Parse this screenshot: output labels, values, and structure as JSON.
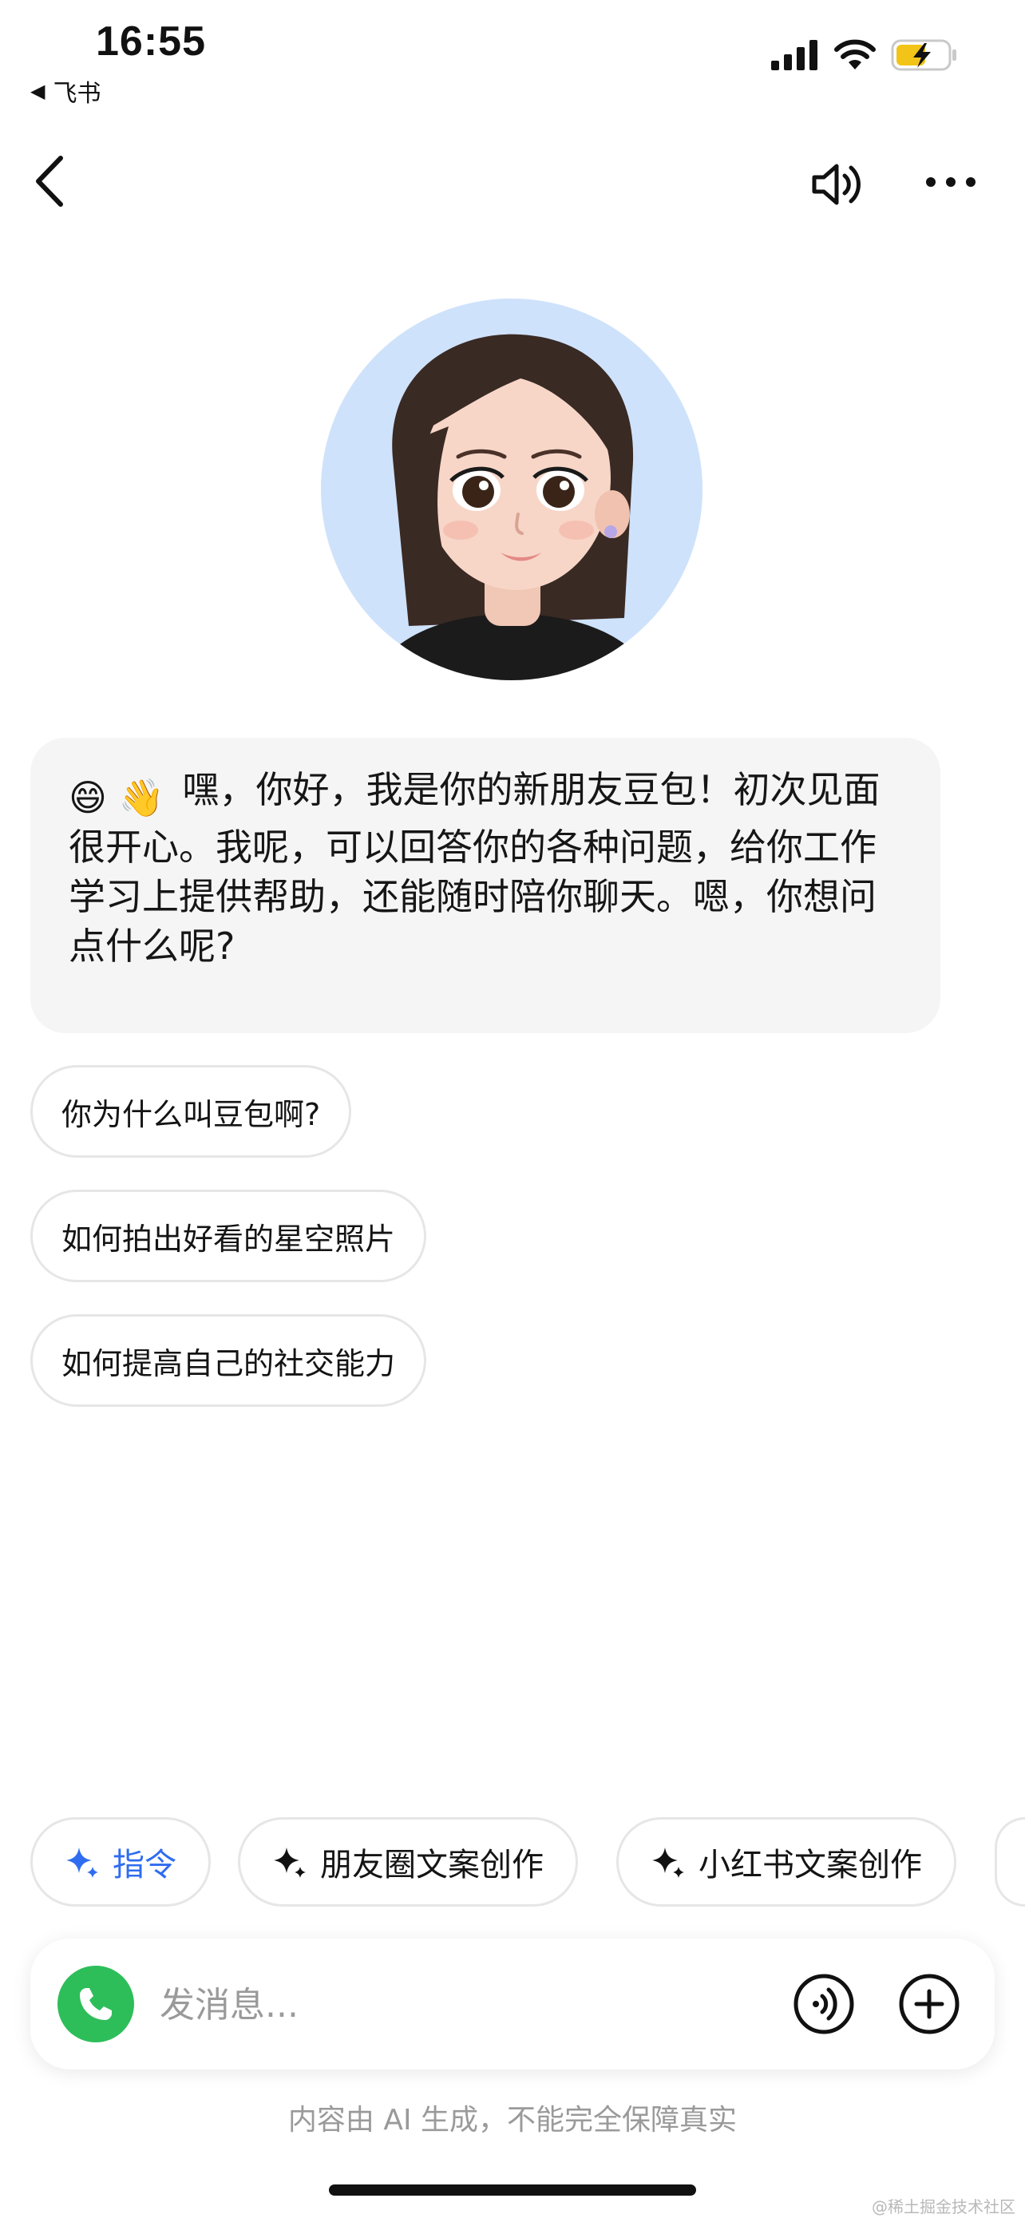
{
  "status_bar": {
    "time": "16:55",
    "back_app": "飞书"
  },
  "nav": {
    "back_icon": "chevron-left-icon",
    "sound_icon": "speaker-icon",
    "more_icon": "more-icon"
  },
  "greeting": {
    "emojis": "😄 👋",
    "text": "嘿，你好，我是你的新朋友豆包！初次见面很开心。我呢，可以回答你的各种问题，给你工作学习上提供帮助，还能随时陪你聊天。嗯，你想问点什么呢?"
  },
  "suggestions": [
    "你为什么叫豆包啊?",
    "如何拍出好看的星空照片",
    "如何提高自己的社交能力"
  ],
  "chips": [
    {
      "label": "指令",
      "icon": "sparkle-icon"
    },
    {
      "label": "朋友圈文案创作",
      "icon": "sparkle-icon"
    },
    {
      "label": "小红书文案创作",
      "icon": "sparkle-icon"
    }
  ],
  "composer": {
    "placeholder": "发消息...",
    "call_icon": "phone-icon",
    "voice_icon": "voice-wave-icon",
    "add_icon": "plus-circle-icon"
  },
  "disclaimer": "内容由 AI 生成，不能完全保障真实",
  "watermark": "@稀土掘金技术社区",
  "colors": {
    "accent_blue": "#2f6cf0",
    "call_green": "#2dbe5a",
    "bubble_bg": "#f5f5f5",
    "avatar_bg": "#cfe2fb"
  }
}
